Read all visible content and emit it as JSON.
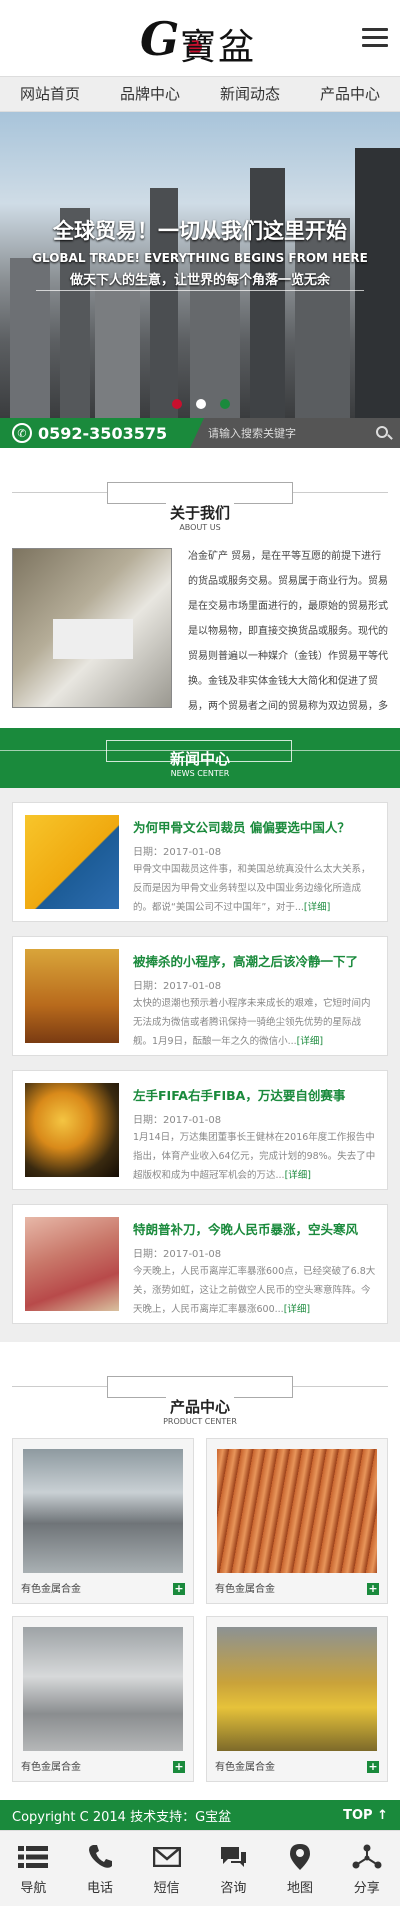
{
  "header": {
    "logo_letter": "G",
    "logo_text": "寶盆"
  },
  "nav": [
    {
      "label": "网站首页"
    },
    {
      "label": "品牌中心"
    },
    {
      "label": "新闻动态"
    },
    {
      "label": "产品中心"
    }
  ],
  "banner": {
    "title": "全球贸易！一切从我们这里开始",
    "subtitle_en": "GLOBAL TRADE! EVERYTHING BEGINS FROM HERE",
    "subtitle_cn": "做天下人的生意，让世界的每个角落一览无余"
  },
  "contact": {
    "phone": "0592-3503575",
    "search_placeholder": "请输入搜索关键字"
  },
  "about": {
    "title": "关于我们",
    "subtitle": "ABOUT US",
    "text": "冶金矿产 贸易，是在平等互愿的前提下进行的货品或服务交易。贸易属于商业行为。贸易是在交易市场里面进行的，最原始的贸易形式是以物易物，即直接交换货品或服务。现代的贸易则普遍以一种媒介（金钱）作贸易平等代换。金钱及非实体金钱大大简化和促进了贸易，两个贸易者之间的贸易称为双边贸易，多于两"
  },
  "news": {
    "title": "新闻中心",
    "subtitle": "NEWS CENTER",
    "date_label": "日期：",
    "more_label": "[详细]",
    "items": [
      {
        "title": "为何甲骨文公司裁员 偏偏要选中国人？",
        "date": "2017-01-08",
        "desc": "甲骨文中国裁员这件事，和美国总统真没什么太大关系，反而是因为甲骨文业务转型以及中国业务边缘化所造成的。都说“美国公司不过中国年”，对于..."
      },
      {
        "title": "被捧杀的小程序，高潮之后该冷静一下了",
        "date": "2017-01-08",
        "desc": "太快的退潮也预示着小程序未来成长的艰难，它短时间内无法成为微信或者腾讯保持一骑绝尘领先优势的星际战舰。1月9日，酝酿一年之久的微信小..."
      },
      {
        "title": "左手FIFA右手FIBA，万达要自创赛事",
        "date": "2017-01-08",
        "desc": "1月14日，万达集团董事长王健林在2016年度工作报告中指出，体育产业收入64亿元，完成计划的98%。失去了中超版权和成为中超冠军机会的万达..."
      },
      {
        "title": "特朗普补刀，今晚人民币暴涨，空头寒风",
        "date": "2017-01-08",
        "desc": "今天晚上，人民币离岸汇率暴涨600点，已经突破了6.8大关，涨势如虹，这让之前做空人民币的空头寒意阵阵。今天晚上，人民币离岸汇率暴涨600..."
      }
    ]
  },
  "products": {
    "title": "产品中心",
    "subtitle": "PRODUCT CENTER",
    "items": [
      {
        "label": "有色金属合金"
      },
      {
        "label": "有色金属合金"
      },
      {
        "label": "有色金属合金"
      },
      {
        "label": "有色金属合金"
      }
    ]
  },
  "footer": {
    "copyright": "Copyright C 2014 技术支持：G宝盆",
    "top_label": "TOP"
  },
  "bottom_nav": [
    {
      "label": "导航",
      "icon": "list-icon"
    },
    {
      "label": "电话",
      "icon": "phone-icon"
    },
    {
      "label": "短信",
      "icon": "mail-icon"
    },
    {
      "label": "咨询",
      "icon": "chat-icon"
    },
    {
      "label": "地图",
      "icon": "map-pin-icon"
    },
    {
      "label": "分享",
      "icon": "share-icon"
    }
  ],
  "colors": {
    "brand_green": "#1a8a3c",
    "accent_red": "#c8102e"
  }
}
